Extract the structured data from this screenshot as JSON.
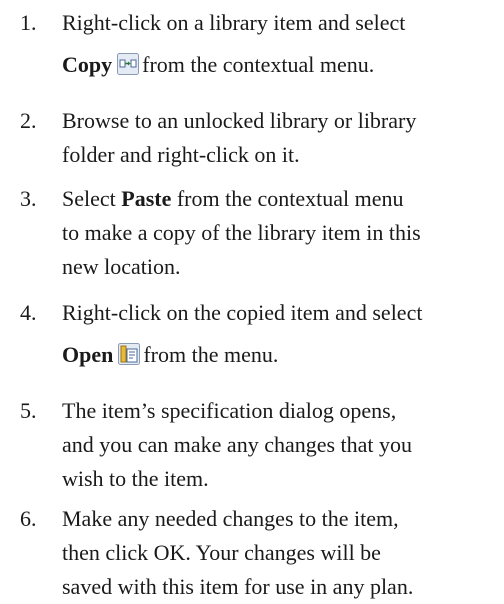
{
  "steps": [
    {
      "number": "1.",
      "lines": [
        "Right-click on a library item and select",
        {
          "bold": "Copy",
          "icon": "copy-icon",
          "rest": "from the contextual menu."
        }
      ]
    },
    {
      "number": "2.",
      "lines": [
        "Browse to an unlocked library or library",
        "folder and right-click on it."
      ]
    },
    {
      "number": "3.",
      "lines": [
        {
          "pre": "Select ",
          "bold": "Paste",
          "rest": " from the contextual menu"
        },
        "to make a copy of the library item in this",
        "new location."
      ]
    },
    {
      "number": "4.",
      "lines": [
        "Right-click on the copied item and select",
        {
          "bold": "Open",
          "icon": "open-icon",
          "rest": "from the menu."
        }
      ]
    },
    {
      "number": "5.",
      "lines": [
        "The item’s specification dialog opens,",
        "and you can make any changes that you",
        "wish to the item."
      ]
    },
    {
      "number": "6.",
      "lines": [
        "Make any needed changes to the item,",
        "then click OK. Your changes will be",
        "saved with this item for use in any plan."
      ]
    }
  ]
}
